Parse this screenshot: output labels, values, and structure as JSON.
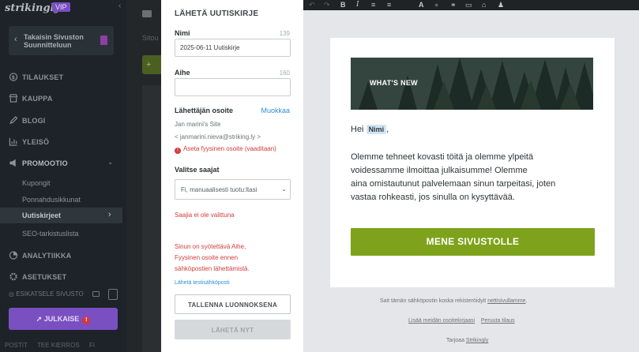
{
  "sidebar": {
    "logo": "strikingly",
    "badge": "VIP",
    "collapse": "‹",
    "back_button": {
      "line1": "Takaisin Sivuston",
      "line2": "Suunnitteluun"
    },
    "nav": [
      {
        "label": "TILAUKSET",
        "icon": "dollar-icon"
      },
      {
        "label": "KAUPPA",
        "icon": "store-icon"
      },
      {
        "label": "BLOGI",
        "icon": "pen-icon"
      },
      {
        "label": "YLEISÖ",
        "icon": "chart-icon"
      },
      {
        "label": "PROMOOTIO",
        "icon": "megaphone-icon"
      }
    ],
    "promo_sub": [
      "Kupongit",
      "Ponnahdusikkunat",
      "Uutiskirjeet",
      "SEO-tarkistuslista"
    ],
    "nav2": [
      {
        "label": "ANALYTIIKKA",
        "icon": "analytics-icon"
      },
      {
        "label": "ASETUKSET",
        "icon": "settings-icon"
      }
    ],
    "preview_label": "ESIKATSELE SIVUSTO",
    "publish_label": "JULKAISE",
    "publish_alert": "!",
    "bottom_links": [
      "POSTIT",
      "TEE KIERROS",
      "FI"
    ]
  },
  "bg_page": {
    "text": "Sitou",
    "button": "+"
  },
  "form": {
    "title": "LÄHETÄ UUTISKIRJE",
    "name_label": "Nimi",
    "name_count": "139",
    "name_value": "2025-06-11 Uutiskirje",
    "subject_label": "Aihe",
    "subject_count": "160",
    "subject_value": "",
    "sender_label": "Lähettäjän osoite",
    "edit_link": "Muokkaa",
    "sender_name": "Jan marini's Site",
    "sender_email": "< janmarini.nieva@striking.ly >",
    "address_warning": "Aseta fyysinen osoite (vaaditaan)",
    "recipients_label": "Valitse saajat",
    "recipients_value": "Fi, manuaalisesti tuotu:ltasi",
    "recipients_error": "Saajia ei ole valittuna",
    "validation_error": [
      "Sinun on syötettävä Aihe,",
      "Fyysinen osoite ennen",
      "sähköpostien lähettämistä."
    ],
    "test_link": "Lähetä testisähköposti",
    "draft_button": "TALLENNA LUONNOKSENA",
    "send_button": "LÄHETÄ NYT"
  },
  "toolbar": {
    "undo": "↶",
    "redo": "↷",
    "bold": "B",
    "italic": "I",
    "align_left": "≡",
    "align_center": "≡",
    "text": "A",
    "color": "●",
    "link": "⚭",
    "button": "▭",
    "image": "⌂",
    "person": "♟"
  },
  "email": {
    "hero_title": "WHAT'S NEW",
    "greeting": "Hei",
    "merge_tag": "Nimi",
    "greeting_end": ",",
    "body": [
      "Olemme tehneet kovasti töitä ja olemme ylpeitä",
      "voidessamme ilmoittaa julkaisumme! Olemme",
      "aina omistautunut palvelemaan sinun tarpeitasi, joten",
      "vastaa rohkeasti, jos sinulla on kysyttävää."
    ],
    "cta": "MENE SIVUSTOLLE",
    "footer_text": "Sait tämän sähköpostin koska rekisteröidyit",
    "footer_link": "nettisivullamme",
    "footer_period": ".",
    "add_link": "Lisää meidän osoitekirjaasi",
    "unsubscribe": "Peruuta tilaus",
    "powered": "Tarjoaa",
    "powered_link": "Strikingly"
  },
  "colors": {
    "sidebar_bg": "#1d2328",
    "accent_purple": "#7a4fc2",
    "cta_green": "#7ea21b",
    "link_blue": "#3190d6",
    "error_red": "#d23c3c"
  }
}
